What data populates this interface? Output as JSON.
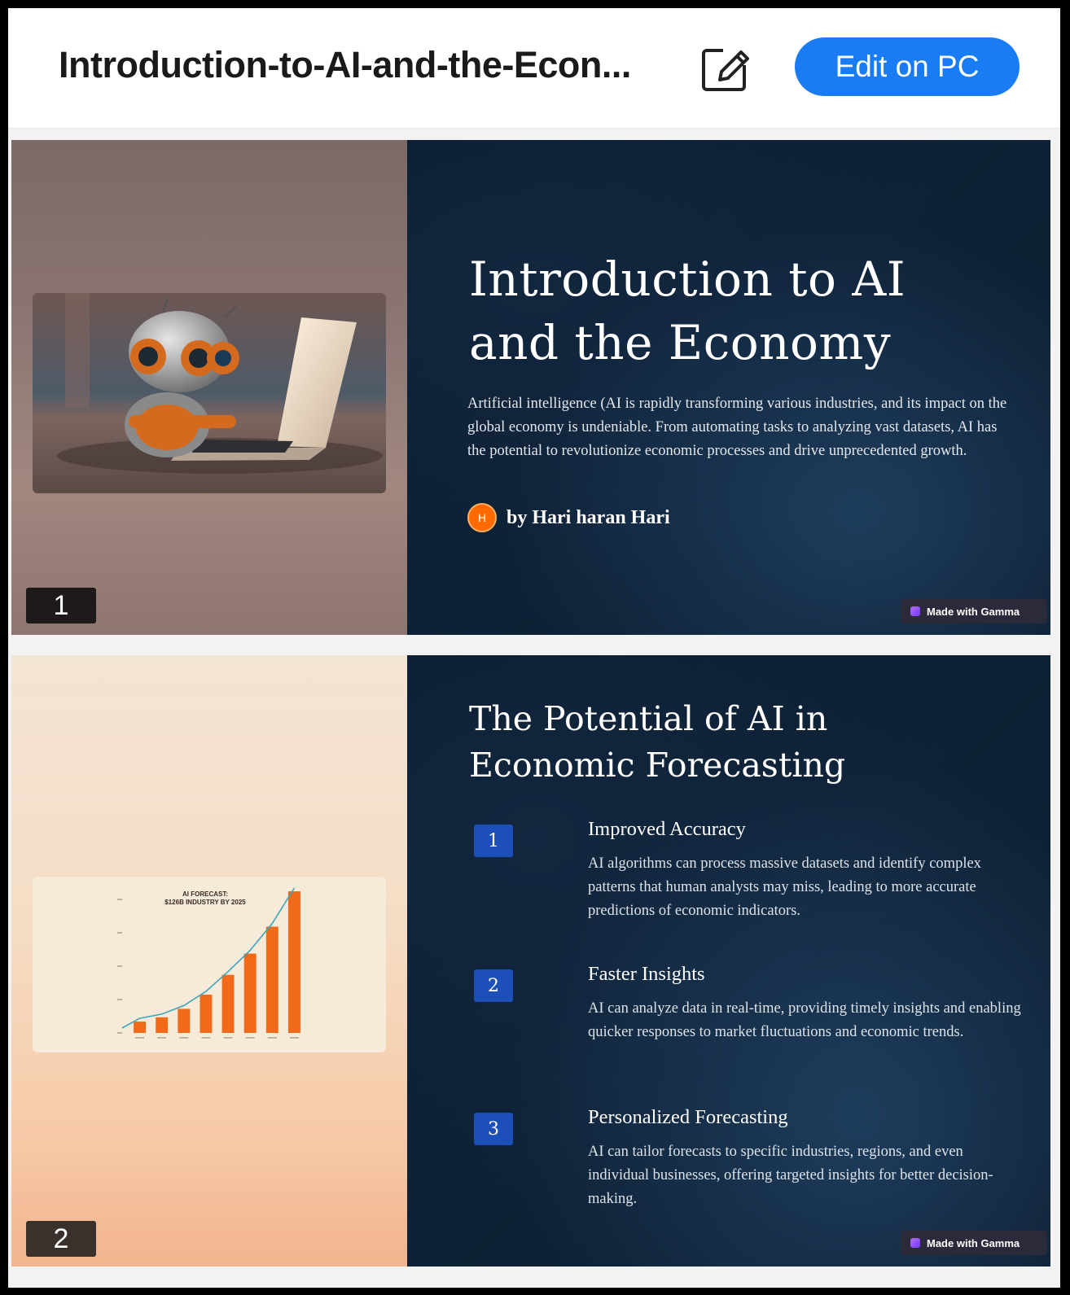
{
  "header": {
    "doc_title": "Introduction-to-AI-and-the-Econ...",
    "edit_pc_label": "Edit on PC",
    "accent": "#1a7cf5"
  },
  "slides": [
    {
      "number": "1",
      "title_line1": "Introduction to AI",
      "title_line2": "and the Economy",
      "body": "Artificial intelligence (AI  is rapidly transforming various industries, and its impact on the global economy is undeniable. From automating tasks to analyzing vast datasets, AI has the potential to revolutionize economic processes and drive unprecedented growth.",
      "author_initial": "H",
      "author": "by Hari haran Hari",
      "badge": "Made with Gamma",
      "image_icon": "robot-laptop-image"
    },
    {
      "number": "2",
      "title_line1": "The Potential of AI in",
      "title_line2": "Economic Forecasting",
      "points": [
        {
          "num": "1",
          "title": "Improved Accuracy",
          "body": "AI algorithms can process massive datasets and identify complex patterns that human analysts may miss, leading to more accurate predictions of economic indicators."
        },
        {
          "num": "2",
          "title": "Faster Insights",
          "body": "AI can analyze data in real-time, providing timely insights and enabling quicker responses to market fluctuations and economic trends."
        },
        {
          "num": "3",
          "title": "Personalized Forecasting",
          "body": "AI can tailor forecasts to specific industries, regions, and even individual businesses, offering targeted insights for better decision-making."
        }
      ],
      "badge": "Made with Gamma",
      "chart_title_line1": "AI FORECAST:",
      "chart_title_line2": "$126B INDUSTRY BY 2025"
    }
  ],
  "chart_data": {
    "type": "bar",
    "title": "AI FORECAST: $126B INDUSTRY BY 2025",
    "values": [
      8,
      11,
      17,
      27,
      41,
      56,
      75,
      100
    ],
    "bar_color": "#f06a1a",
    "trend_color": "#3aa6b9"
  }
}
